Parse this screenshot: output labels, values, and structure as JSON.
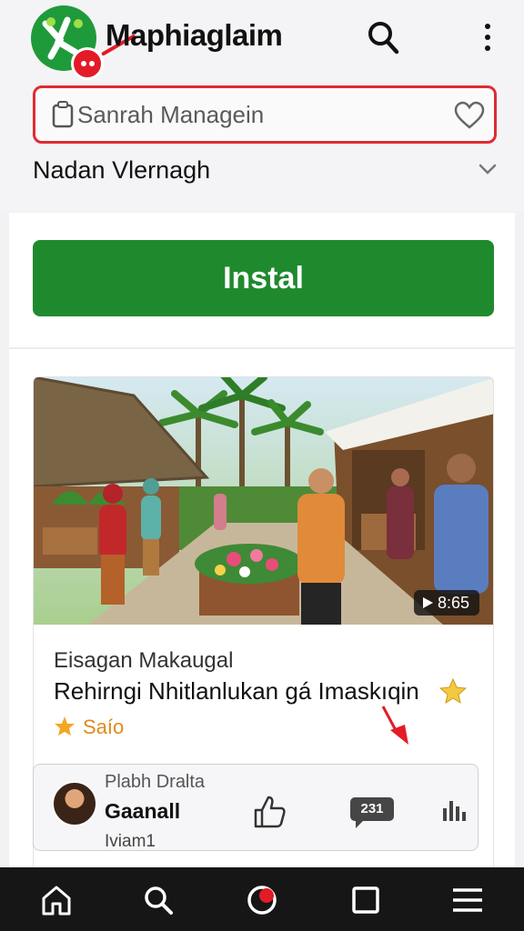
{
  "header": {
    "app_title": "Maphiaglaim",
    "logo_icon": "app-logo-icon",
    "search_icon": "search-icon",
    "more_icon": "more-vertical-icon"
  },
  "search": {
    "placeholder": "Sanrah Managein",
    "value": "",
    "left_icon": "clipboard-icon",
    "right_icon": "heart-icon"
  },
  "dropdown": {
    "label": "Nadan Vlernagh",
    "icon": "chevron-down-icon"
  },
  "install": {
    "label": "Instal"
  },
  "post": {
    "duration": "8:65",
    "subtitle": "Eisagan Makaugal",
    "title": "Rehirngi Nhitlanlukan gá Imaskıqin",
    "rating_label": "Saío"
  },
  "author": {
    "overline": "Plabh Dralta",
    "name": "Gaanall",
    "meta": "Iviam1",
    "comment_count": "231",
    "like_icon": "thumbs-up-icon",
    "stats_icon": "bar-chart-icon"
  },
  "bottom_nav": {
    "items": [
      "home-icon",
      "search-icon",
      "app-logo-icon",
      "square-icon",
      "menu-icon"
    ]
  },
  "colors": {
    "accent_green": "#1f8a2d",
    "accent_red": "#df2b33",
    "nav_background": "#161616",
    "rating_star": "#f5a623"
  }
}
